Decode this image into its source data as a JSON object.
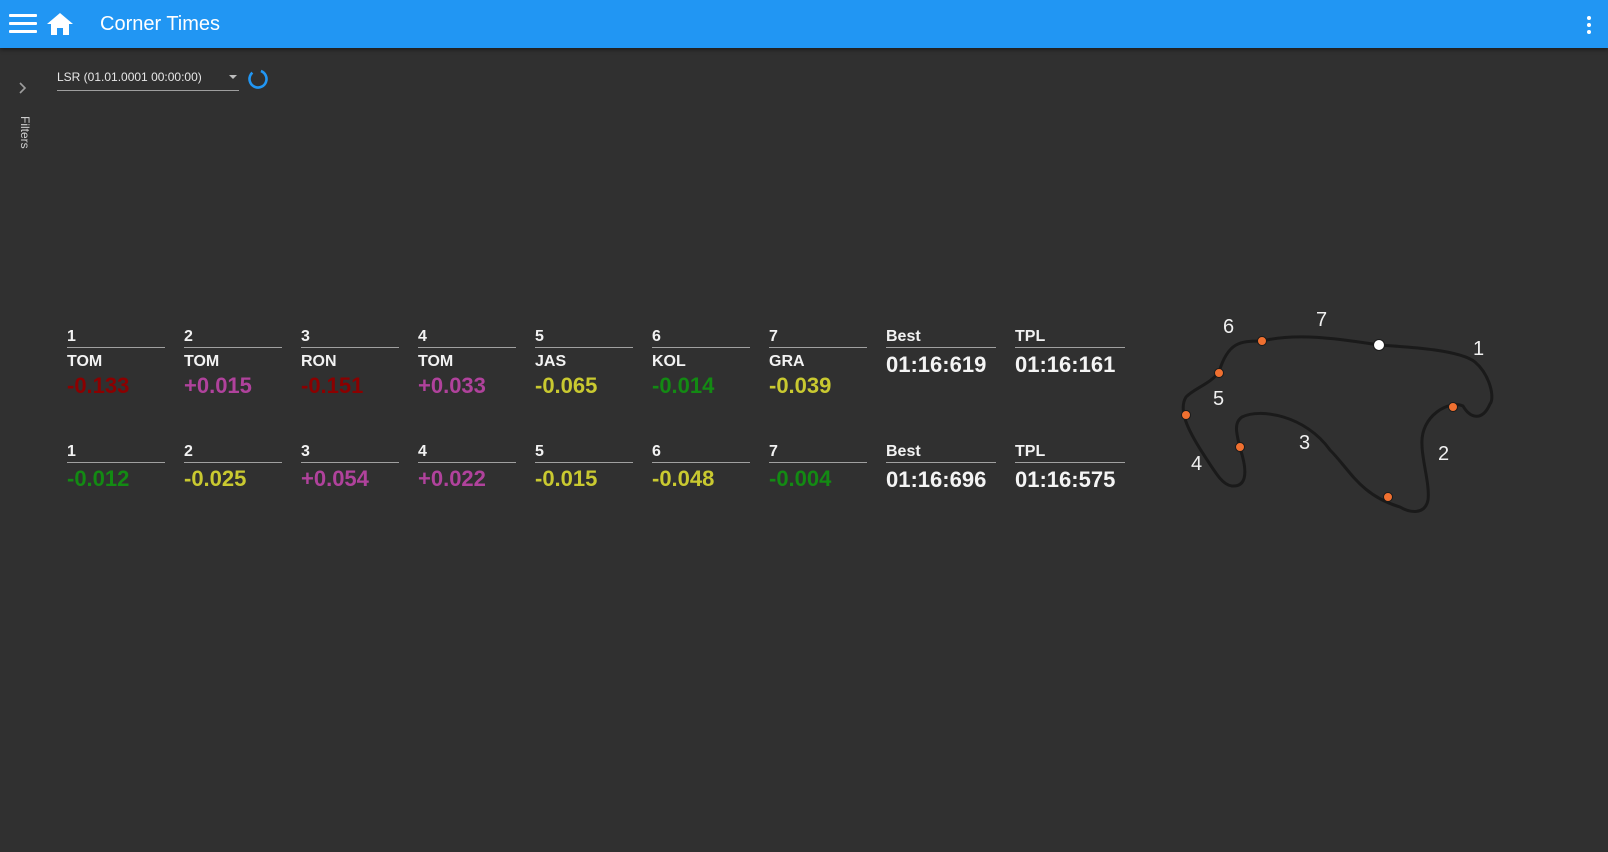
{
  "header": {
    "title": "Corner Times",
    "color": "#2196f3"
  },
  "filters": {
    "label": "Filters"
  },
  "session": {
    "selected": "LSR (01.01.0001 00:00:00)"
  },
  "colors": {
    "red": "#8b0000",
    "purple": "#b0429c",
    "yellow": "#c9c930",
    "green": "#138a13"
  },
  "rows": [
    {
      "corners": [
        {
          "label": "1",
          "driver": "TOM",
          "delta": "-0.133",
          "status": "red"
        },
        {
          "label": "2",
          "driver": "TOM",
          "delta": "+0.015",
          "status": "purple"
        },
        {
          "label": "3",
          "driver": "RON",
          "delta": "-0.151",
          "status": "red"
        },
        {
          "label": "4",
          "driver": "TOM",
          "delta": "+0.033",
          "status": "purple"
        },
        {
          "label": "5",
          "driver": "JAS",
          "delta": "-0.065",
          "status": "yellow"
        },
        {
          "label": "6",
          "driver": "KOL",
          "delta": "-0.014",
          "status": "green"
        },
        {
          "label": "7",
          "driver": "GRA",
          "delta": "-0.039",
          "status": "yellow"
        }
      ],
      "best": {
        "label": "Best",
        "time": "01:16:619"
      },
      "tpl": {
        "label": "TPL",
        "time": "01:16:161"
      }
    },
    {
      "corners": [
        {
          "label": "1",
          "driver": "",
          "delta": "-0.012",
          "status": "green"
        },
        {
          "label": "2",
          "driver": "",
          "delta": "-0.025",
          "status": "yellow"
        },
        {
          "label": "3",
          "driver": "",
          "delta": "+0.054",
          "status": "purple"
        },
        {
          "label": "4",
          "driver": "",
          "delta": "+0.022",
          "status": "purple"
        },
        {
          "label": "5",
          "driver": "",
          "delta": "-0.015",
          "status": "yellow"
        },
        {
          "label": "6",
          "driver": "",
          "delta": "-0.048",
          "status": "yellow"
        },
        {
          "label": "7",
          "driver": "",
          "delta": "-0.004",
          "status": "green"
        }
      ],
      "best": {
        "label": "Best",
        "time": "01:16:696"
      },
      "tpl": {
        "label": "TPL",
        "time": "01:16:575"
      }
    }
  ],
  "track": {
    "corner_labels": [
      "1",
      "2",
      "3",
      "4",
      "5",
      "6",
      "7"
    ],
    "line_color": "#1a1a1a",
    "marker_color": "#f07030",
    "start_marker_color": "#ffffff"
  }
}
